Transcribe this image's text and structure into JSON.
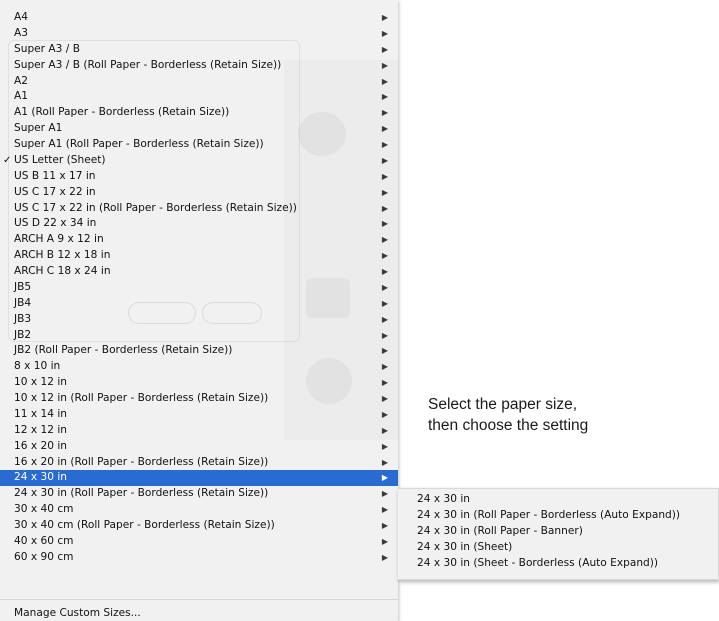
{
  "menu": {
    "items": [
      {
        "label": "A4"
      },
      {
        "label": "A3"
      },
      {
        "label": "Super A3 / B"
      },
      {
        "label": "Super A3 / B (Roll Paper - Borderless (Retain Size))"
      },
      {
        "label": "A2"
      },
      {
        "label": "A1"
      },
      {
        "label": "A1 (Roll Paper - Borderless (Retain Size))"
      },
      {
        "label": "Super A1"
      },
      {
        "label": "Super A1 (Roll Paper - Borderless (Retain Size))"
      },
      {
        "label": "US Letter (Sheet)",
        "checked": true
      },
      {
        "label": "US B 11 x 17 in"
      },
      {
        "label": "US C 17 x 22 in"
      },
      {
        "label": "US C 17 x 22 in (Roll Paper - Borderless (Retain Size))"
      },
      {
        "label": "US D 22 x 34 in"
      },
      {
        "label": "ARCH A 9 x 12 in"
      },
      {
        "label": "ARCH B 12 x 18 in"
      },
      {
        "label": "ARCH C 18 x 24 in"
      },
      {
        "label": "JB5"
      },
      {
        "label": "JB4"
      },
      {
        "label": "JB3"
      },
      {
        "label": "JB2"
      },
      {
        "label": "JB2 (Roll Paper - Borderless (Retain Size))"
      },
      {
        "label": "8 x 10 in"
      },
      {
        "label": "10 x 12 in"
      },
      {
        "label": "10 x 12 in (Roll Paper - Borderless (Retain Size))"
      },
      {
        "label": "11 x 14 in"
      },
      {
        "label": "12 x 12 in"
      },
      {
        "label": "16 x 20 in"
      },
      {
        "label": "16 x 20 in (Roll Paper - Borderless (Retain Size))"
      },
      {
        "label": "24 x 30 in",
        "highlighted": true
      },
      {
        "label": "24 x 30 in (Roll Paper - Borderless (Retain Size))"
      },
      {
        "label": "30 x 40 cm"
      },
      {
        "label": "30 x 40 cm (Roll Paper - Borderless (Retain Size))"
      },
      {
        "label": "40 x 60 cm"
      },
      {
        "label": "60 x 90 cm"
      }
    ],
    "arrow_glyph": "▶",
    "check_glyph": "✓",
    "manage_label": "Manage Custom Sizes..."
  },
  "submenu": {
    "items": [
      {
        "label": "24 x 30 in"
      },
      {
        "label": "24 x 30 in (Roll Paper - Borderless (Auto Expand))"
      },
      {
        "label": "24 x 30 in (Roll Paper - Banner)"
      },
      {
        "label": "24 x 30 in (Sheet)"
      },
      {
        "label": "24 x 30 in (Sheet - Borderless (Auto Expand))"
      }
    ]
  },
  "callout": {
    "line1": "Select the paper size,",
    "line2": "then choose the setting"
  },
  "colors": {
    "highlight": "#2a6bd1",
    "menu_bg": "#f1f1f1"
  }
}
